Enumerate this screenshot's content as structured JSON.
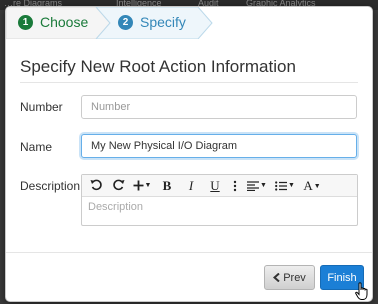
{
  "background": {
    "items": [
      "…re Diagrams",
      "Intelligence",
      "Audit",
      "Graphic Analytics"
    ]
  },
  "wizard": {
    "steps": [
      {
        "number": "1",
        "label": "Choose"
      },
      {
        "number": "2",
        "label": "Specify"
      }
    ]
  },
  "dialog": {
    "title": "Specify New Root Action Information"
  },
  "form": {
    "number": {
      "label": "Number",
      "value": "",
      "placeholder": "Number"
    },
    "name": {
      "label": "Name",
      "value": "My New Physical I/O Diagram"
    },
    "description": {
      "label": "Description",
      "placeholder": "Description"
    }
  },
  "toolbar": {
    "items": [
      "undo-icon",
      "redo-icon",
      "insert-icon",
      "bold-icon",
      "italic-icon",
      "underline-icon",
      "more-icon",
      "align-icon",
      "list-icon",
      "font-size-icon"
    ],
    "bold_label": "B",
    "italic_label": "I",
    "underline_label": "U",
    "font_label": "A"
  },
  "buttons": {
    "prev_label": "Prev",
    "finish_label": "Finish"
  },
  "colors": {
    "step1": "#1a7a3a",
    "step2": "#3387b8",
    "primary": "#1b7fd6"
  }
}
